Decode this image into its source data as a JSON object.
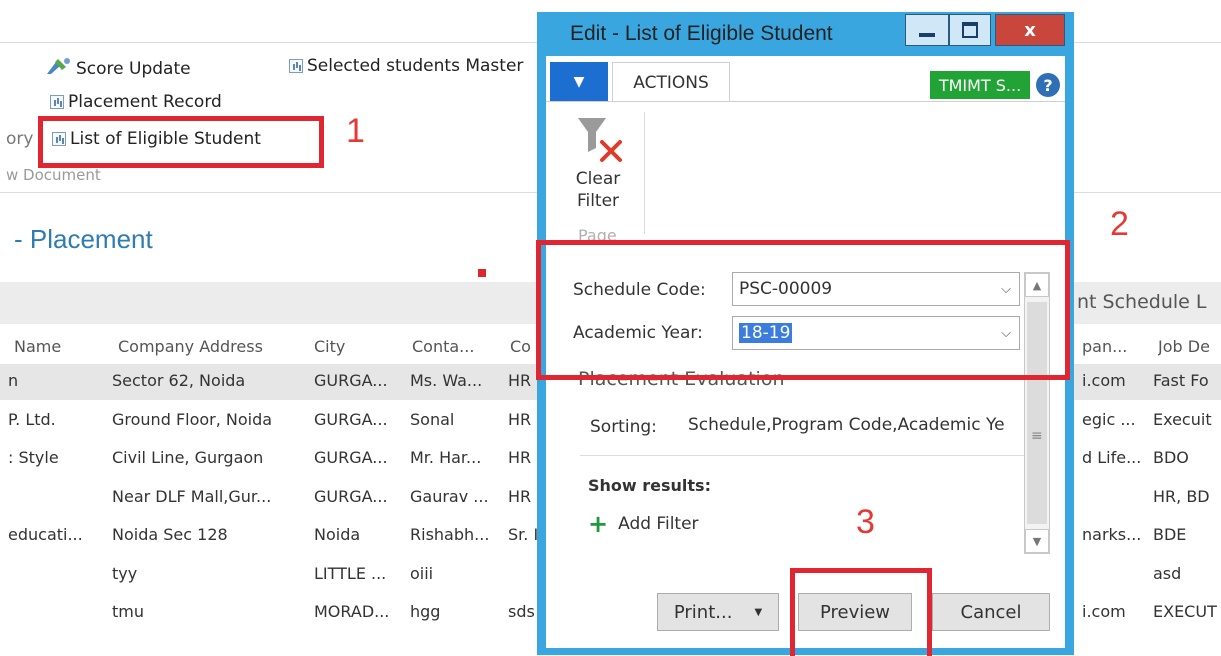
{
  "ribbon": {
    "score_update": "Score Update",
    "selected_students_master": "Selected students Master",
    "placement_record": "Placement Record",
    "list_of_eligible_student": "List of Eligible Student",
    "left_fragment": "ory",
    "group_caption": "w Document"
  },
  "page": {
    "title": "- Placement",
    "schedule_label_fragment": "nt Schedule L"
  },
  "table": {
    "columns": [
      "Name",
      "Company Address",
      "City",
      "Conta...",
      "Co"
    ],
    "right_columns": [
      "pan...",
      "Job De"
    ],
    "rows": [
      {
        "name": "n",
        "address": "Sector 62, Noida",
        "city": "GURGA...",
        "contact": "Ms. Wa...",
        "co": "HR",
        "r1": "i.com",
        "r2": "Fast Fo"
      },
      {
        "name": "P. Ltd.",
        "address": "Ground Floor, Noida",
        "city": "GURGA...",
        "contact": "Sonal",
        "co": "HR",
        "r1": "egic ...",
        "r2": "Execuit"
      },
      {
        "name": ": Style",
        "address": "Civil Line, Gurgaon",
        "city": "GURGA...",
        "contact": "Mr. Har...",
        "co": "HR",
        "r1": "d Life...",
        "r2": "BDO"
      },
      {
        "name": "",
        "address": "Near DLF Mall,Gur...",
        "city": "GURGA...",
        "contact": "Gaurav ...",
        "co": "HR",
        "r1": "",
        "r2": "HR, BD"
      },
      {
        "name": "educati...",
        "address": "Noida Sec 128",
        "city": "Noida",
        "contact": "Rishabh...",
        "co": "Sr. I",
        "r1": "narks...",
        "r2": "BDE"
      },
      {
        "name": "",
        "address": "tyy",
        "city": "LITTLE ...",
        "contact": "oiii",
        "co": "",
        "r1": "",
        "r2": "asd"
      },
      {
        "name": "",
        "address": "tmu",
        "city": "MORAD...",
        "contact": "hgg",
        "co": "sds",
        "r1": "i.com",
        "r2": "EXECUT"
      }
    ]
  },
  "dialog": {
    "title": "Edit - List of Eligible Student",
    "close_symbol": "x",
    "tab_actions": "ACTIONS",
    "company_badge": "TMIMT S...",
    "help_symbol": "?",
    "clear_filter": "Clear",
    "clear_filter2": "Filter",
    "group_page": "Page",
    "schedule_code_label": "Schedule Code:",
    "schedule_code_value": "PSC-00009",
    "academic_year_label": "Academic Year:",
    "academic_year_value": "18-19",
    "section_header": "Placement Evaluation",
    "sorting_label": "Sorting:",
    "sorting_value": "Schedule,Program Code,Academic Ye",
    "show_results": "Show results:",
    "add_filter": "Add Filter",
    "print_button": "Print...",
    "preview_button": "Preview",
    "cancel_button": "Cancel"
  },
  "annotations": [
    "1",
    "2",
    "3"
  ],
  "colors": {
    "dialog_frame": "#3aa6df",
    "annotation_red": "#e02631",
    "title_blue": "#2f7cb3",
    "badge_green": "#22a336"
  }
}
